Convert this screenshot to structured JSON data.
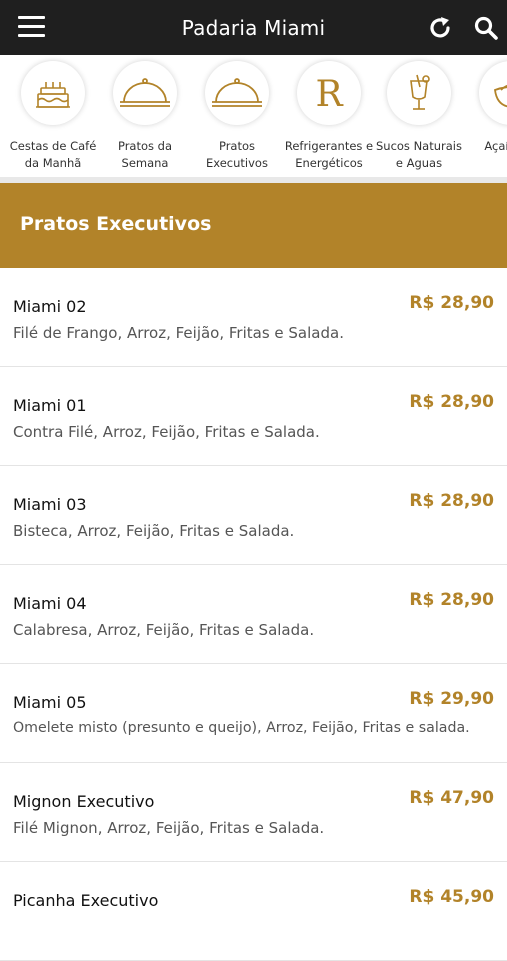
{
  "header": {
    "title": "Padaria Miami",
    "menu_icon": "hamburger-menu-icon",
    "refresh_icon": "refresh-icon",
    "search_icon": "search-icon"
  },
  "categories": [
    {
      "label": "Cestas de Café da Manhã",
      "icon": "cake-icon"
    },
    {
      "label": "Pratos da Semana",
      "icon": "cloche-icon"
    },
    {
      "label": "Pratos Executivos",
      "icon": "cloche-icon"
    },
    {
      "label": "Refrigerantes e Energéticos",
      "icon": "letter-r-icon"
    },
    {
      "label": "Sucos Naturais e Aguas",
      "icon": "cocktail-icon"
    },
    {
      "label": "Açaí e Sh",
      "icon": "bowl-icon"
    }
  ],
  "section": {
    "title": "Pratos Executivos"
  },
  "items": [
    {
      "name": "Miami 02",
      "desc": "Filé de Frango, Arroz, Feijão, Fritas e Salada.",
      "price": "R$ 28,90"
    },
    {
      "name": "Miami 01",
      "desc": "Contra Filé, Arroz, Feijão, Fritas e Salada.",
      "price": "R$ 28,90"
    },
    {
      "name": "Miami 03",
      "desc": "Bisteca, Arroz, Feijão, Fritas e Salada.",
      "price": "R$ 28,90"
    },
    {
      "name": "Miami 04",
      "desc": "Calabresa, Arroz, Feijão, Fritas e Salada.",
      "price": "R$ 28,90"
    },
    {
      "name": "Miami 05",
      "desc": "Omelete misto (presunto e queijo), Arroz, Feijão, Fritas e salada.",
      "price": "R$ 29,90"
    },
    {
      "name": "Mignon Executivo",
      "desc": "Filé Mignon, Arroz, Feijão, Fritas e Salada.",
      "price": "R$ 47,90"
    },
    {
      "name": "Picanha Executivo",
      "desc": "",
      "price": "R$ 45,90"
    }
  ],
  "colors": {
    "accent": "#b28329",
    "topbar": "#1f1f1f"
  }
}
